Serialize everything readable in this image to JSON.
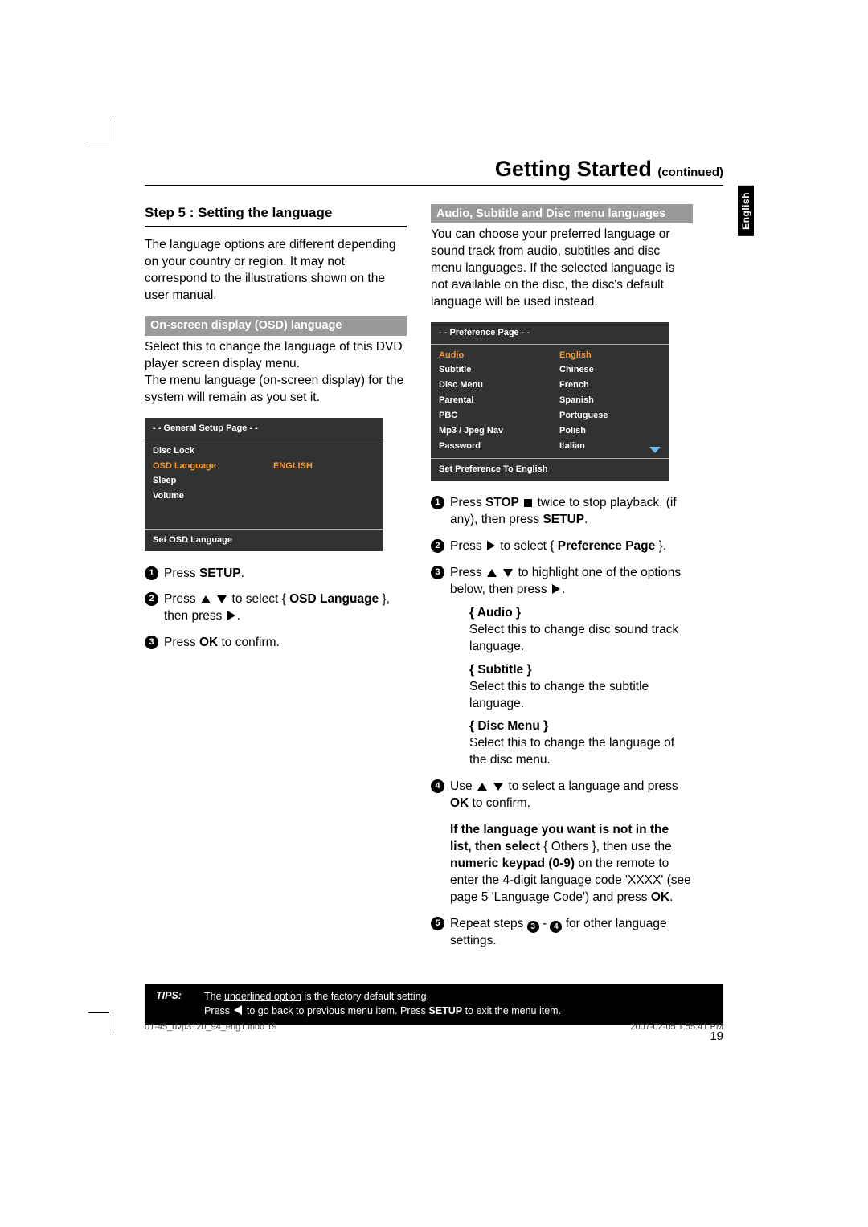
{
  "header": {
    "title": "Getting Started",
    "suffix": "(continued)"
  },
  "side_tab": "English",
  "left": {
    "step_title": "Step 5 : Setting the language",
    "intro": "The language options are different depending on your country or region. It may not correspond to the illustrations shown on the user manual.",
    "sub_head": "On-screen display (OSD) language",
    "sub_body": "Select this to change the language of this DVD player screen display menu.\nThe menu language (on-screen display) for the system will remain as you set it.",
    "osd": {
      "title": "- -   General Setup Page   - -",
      "rows": [
        {
          "l": "Disc Lock",
          "r": "",
          "hl": false
        },
        {
          "l": "OSD Language",
          "r": "ENGLISH",
          "hl": true
        },
        {
          "l": "Sleep",
          "r": "",
          "hl": false
        },
        {
          "l": "Volume",
          "r": "",
          "hl": false
        }
      ],
      "footer": "Set OSD Language"
    },
    "steps": {
      "s1_a": "Press ",
      "s1_b": "SETUP",
      "s1_c": ".",
      "s2_a": "Press ",
      "s2_b": " to select { ",
      "s2_c": "OSD Language",
      "s2_d": " }, then press ",
      "s2_e": ".",
      "s3_a": "Press ",
      "s3_b": "OK",
      "s3_c": " to confirm."
    }
  },
  "right": {
    "sub_head": "Audio, Subtitle and Disc menu languages",
    "intro": "You can choose your preferred language or sound track from audio, subtitles and disc menu languages. If the selected language is not available on the disc, the disc's default language will be used instead.",
    "osd": {
      "title": "- -   Preference Page   - -",
      "rows": [
        {
          "l": "Audio",
          "r": "English",
          "hl": true
        },
        {
          "l": "Subtitle",
          "r": "Chinese",
          "hl": false
        },
        {
          "l": "Disc Menu",
          "r": "French",
          "hl": false
        },
        {
          "l": "Parental",
          "r": "Spanish",
          "hl": false
        },
        {
          "l": "PBC",
          "r": "Portuguese",
          "hl": false
        },
        {
          "l": "Mp3 / Jpeg Nav",
          "r": "Polish",
          "hl": false
        },
        {
          "l": "Password",
          "r": "Italian",
          "hl": false
        }
      ],
      "footer": "Set Preference To English"
    },
    "steps": {
      "s1_a": "Press ",
      "s1_b": "STOP",
      "s1_c": " twice to stop playback, (if any), then press ",
      "s1_d": "SETUP",
      "s1_e": ".",
      "s2_a": "Press ",
      "s2_b": " to select { ",
      "s2_c": "Preference Page",
      "s2_d": " }.",
      "s3_a": "Press ",
      "s3_b": " to highlight one of the options below, then press ",
      "s3_c": ".",
      "optA_t": "{ Audio }",
      "optA_d": "Select this to change disc sound track language.",
      "optB_t": "{ Subtitle }",
      "optB_d": "Select this to change the subtitle language.",
      "optC_t": "{ Disc Menu }",
      "optC_d": "Select this to change the language of the disc menu.",
      "s4_a": "Use ",
      "s4_b": " to select a language and press ",
      "s4_c": "OK",
      "s4_d": " to confirm.",
      "note_a": "If the language you want is not in the list, then select",
      "note_b": " { Others }, then use the ",
      "note_c": "numeric keypad (0-9)",
      "note_d": " on the remote to enter the 4-digit language code 'XXXX' (see page 5 'Language Code') and press ",
      "note_e": "OK",
      "note_f": ".",
      "s5_a": "Repeat steps ",
      "s5_b": " - ",
      "s5_c": " for other language settings."
    }
  },
  "tips": {
    "label": "TIPS:",
    "l1_a": "The ",
    "l1_b": "underlined option",
    "l1_c": " is the factory default setting.",
    "l2_a": "Press ",
    "l2_b": " to go back to previous menu item. Press ",
    "l2_c": "SETUP",
    "l2_d": " to exit the menu item."
  },
  "page_number": "19",
  "footer": {
    "left": "01-45_dvp3120_94_eng1.indd   19",
    "right": "2007-02-05   1:55:41 PM"
  }
}
